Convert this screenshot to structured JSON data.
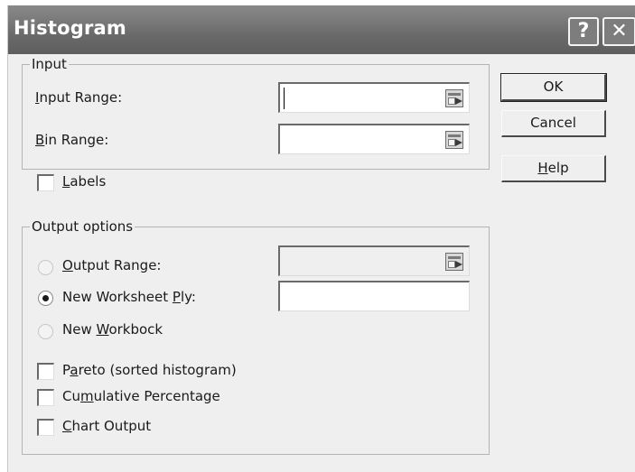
{
  "window": {
    "title": "Histogram",
    "help_glyph": "?",
    "close_glyph": "✕"
  },
  "input_group": {
    "legend": "Input",
    "input_range": {
      "label_prefix": "",
      "label_accel": "I",
      "label_rest": "nput Range:",
      "value": ""
    },
    "bin_range": {
      "label_prefix": "",
      "label_accel": "B",
      "label_rest": "in Range:",
      "value": ""
    },
    "labels_checkbox": {
      "label_prefix": "",
      "label_accel": "L",
      "label_rest": "abels",
      "checked": false
    }
  },
  "output_group": {
    "legend": "Output options",
    "output_range": {
      "label_prefix": "",
      "label_accel": "O",
      "label_rest": "utput Range:",
      "selected": false,
      "value": ""
    },
    "new_worksheet_ply": {
      "label_prefix": "New Worksheet ",
      "label_accel": "P",
      "label_rest": "ly:",
      "selected": true,
      "value": ""
    },
    "new_workbook": {
      "label_prefix": "New ",
      "label_accel": "W",
      "label_rest": "orkbock",
      "selected": false
    },
    "pareto": {
      "label_prefix": "P",
      "label_accel": "a",
      "label_rest": "reto (sorted histogram)",
      "checked": false
    },
    "cumulative": {
      "label_prefix": "Cu",
      "label_accel": "m",
      "label_rest": "ulative Percentage",
      "checked": false
    },
    "chart_output": {
      "label_prefix": "",
      "label_accel": "C",
      "label_rest": "hart Output",
      "checked": false
    }
  },
  "buttons": {
    "ok": {
      "label": "OK"
    },
    "cancel": {
      "label": "Cancel"
    },
    "help": {
      "label_accel": "H",
      "label_rest": "elp"
    }
  },
  "icons": {
    "ref_button": "range-selector-icon"
  }
}
